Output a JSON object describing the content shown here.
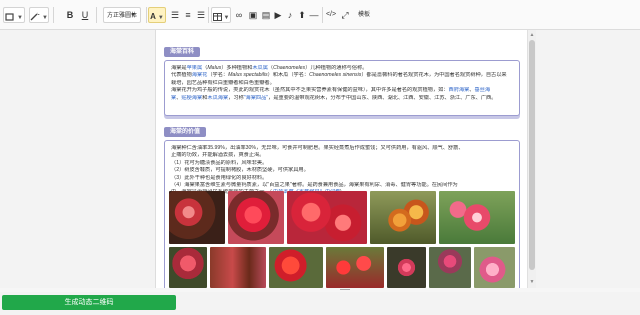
{
  "toolbar": {
    "font_size": "方正雅圆体",
    "html_label": "模板",
    "text_color": "#f2b705"
  },
  "section1": {
    "title": "海棠百科",
    "lines": [
      [
        "海棠是",
        {
          "t": "苹果属",
          "c": "blue"
        },
        "（",
        {
          "t": "Malus",
          "c": "em"
        },
        "）多种植物和",
        {
          "t": "木瓜属",
          "c": "blue"
        },
        "（",
        {
          "t": "Chaenomeles",
          "c": "em"
        },
        "）几种植物的通称与俗称。"
      ],
      [
        "代表植物",
        {
          "t": "海棠花",
          "c": "blue"
        },
        "（学名：",
        {
          "t": "Malus spectabilis",
          "c": "em"
        },
        "）和木瓜（学名：",
        {
          "t": "Chaenomeles sinensis",
          "c": "em"
        },
        "）都是蔷薇科的著名观赏花木，为中国著名观赏树种，自古以来"
      ],
      [
        "栽培，园艺品种有红白重瓣者和白色重瓣者。"
      ],
      [
        "海棠花开为鸡子般的传说，类此的观赏花木（虽然其中不乏果实营养素有保健的益味），其中许多是著名的观赏植物，如：",
        {
          "t": "西府海棠",
          "c": "blue"
        },
        "、",
        {
          "t": "垂丝海",
          "c": "blue"
        }
      ],
      [
        {
          "t": "棠",
          "c": "blue"
        },
        "、",
        {
          "t": "贴梗海棠",
          "c": "blue"
        },
        "和",
        {
          "t": "木瓜海棠",
          "c": "blue"
        },
        "，习称",
        {
          "t": "\"海棠四品\"",
          "c": "blue"
        },
        "，是重要的温带观花树木，分布于中国山东、陕西、湖北、江西、安徽、江苏、浙江、广东、广西。"
      ]
    ]
  },
  "section2": {
    "title": "海棠的价值",
    "lines": [
      [
        "海棠种仁含油率35.99%，出油率30%，无异味，可食并可制肥皂。果实经蒸煮后作成蜜饯；又可供药用，有驱风、顺气、舒筋、"
      ],
      [
        "止痛的功效，并能解酒去痰，爽食止渴。"
      ],
      [
        "（1）花可为糖渍食品的原料，风味非美。"
      ],
      [
        "（2）树皮含鞣质，可提制栲胶，木材质坚硬，可供家具用。"
      ],
      [
        "（3）此外干种也是食用绿化的良好材料。"
      ],
      [
        "（4）海棠果富含维生素与微量钙质素，以\"百益之果\"著称。是药食兼用食品，海棠果有利尿、消毒、健胃等功能。在民间作为"
      ],
      [
        "中，海棠是治疗泌尿系统疾病的主药之一。（",
        {
          "t": "中华本草",
          "c": "note"
        },
        "",
        {
          "t": "《本草纲目》",
          "c": "note"
        },
        {
          "t": "中记载",
          "c": "note"
        },
        "）"
      ]
    ]
  },
  "bottom": {
    "generate_label": "生成动态二维码"
  }
}
